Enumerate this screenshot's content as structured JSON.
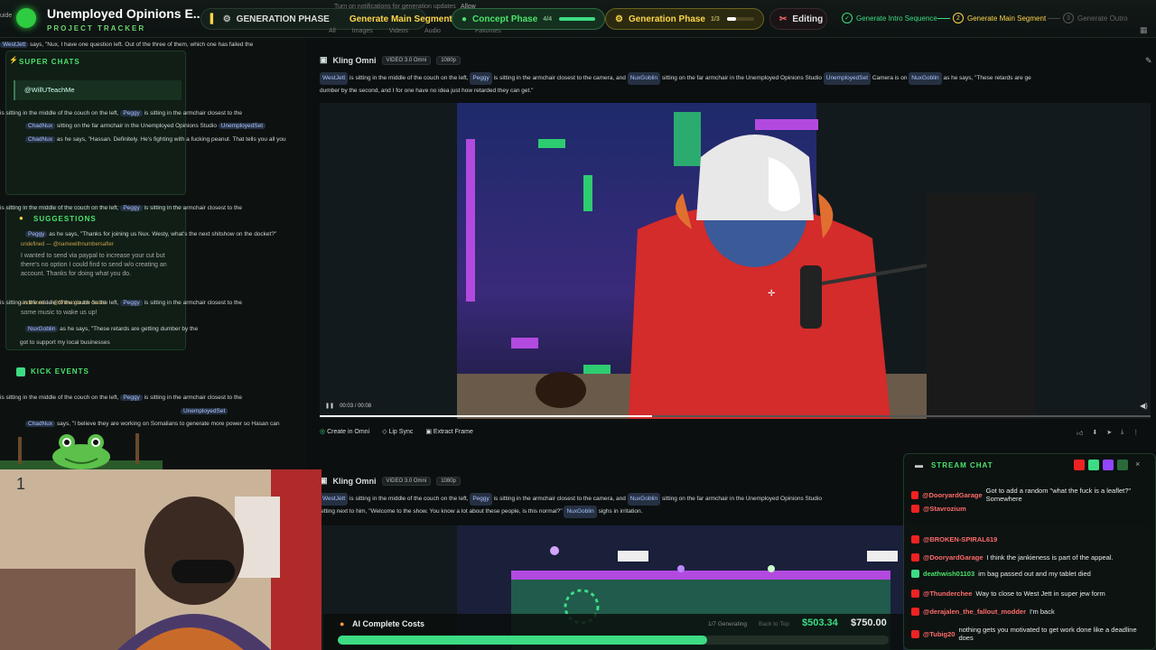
{
  "colors": {
    "accent": "#3ddc84",
    "warn": "#ffd54a",
    "bg": "#0b0f10"
  },
  "topbar": {
    "app_title": "Unemployed Opinions E...",
    "app_subtitle": "PROJECT TRACKER",
    "left_edge": "uide",
    "phase_label": "GENERATION PHASE",
    "phase_action": "Generate Main Segment",
    "notify_text": "Turn on notifications for generation updates",
    "notify_allow": "Allow",
    "filter_tabs": [
      "All",
      "Images",
      "Videos",
      "Audio",
      "Favorites"
    ],
    "concept_phase": {
      "label": "Concept Phase",
      "progress_text": "4/4",
      "fraction": 1.0
    },
    "generation_phase": {
      "label": "Generation Phase",
      "progress_text": "1/3",
      "fraction": 0.33
    },
    "editing_label": "Editing",
    "steps": [
      {
        "num": "✓",
        "label": "Generate Intro Sequence"
      },
      {
        "num": "2",
        "label": "Generate Main Segment"
      },
      {
        "num": "3",
        "label": "Generate Outro"
      }
    ]
  },
  "left": {
    "line0": "says, \"Nux, I have one question left. Out of the three of them, which one has failed the",
    "super_chats_title": "SUPER CHATS",
    "super_chat_user": "@WillUTeachMe",
    "suggestions_title": "SUGGESTIONS",
    "suggestion_user": "undefined — @namewithnumbersafter",
    "suggestion_text": "I wanted to send via paypal to increase your cut but there's no option I could find to send w/o creating an account. Thanks for doing what you do.",
    "suggestion2": "undefined — @Shmalgle the Salad",
    "suggestion2_text": "some music to wake us up!",
    "kick_events_title": "KICK EVENTS",
    "ghost_lines": [
      "is sitting in the middle of the couch on the left,",
      "is sitting in the armchair closest to the",
      "sitting on the far armchair in the Unemployed Opinions Studio",
      "as he says, \"Hassan. Definitely. He's fighting with a fucking peanut. That tells you all you",
      "as he says, \"Thanks for joining us Nux. Westy, what's the next shitshow on the docket?\"",
      "as he says, \"These retards are getting dumber by the",
      "got to support my local businesses",
      "says, \"I believe they are working on Somalians to generate more power so Hasan can"
    ],
    "chips": [
      "WestJett",
      "Peggy",
      "UnemployedSet",
      "ChadNux",
      "NuxGoblin"
    ]
  },
  "main": {
    "card1": {
      "title": "Kling Omni",
      "badges": [
        "VIDEO 3.0 Omni",
        "1080p"
      ],
      "prompt1": "is sitting in the middle of the couch on the left,",
      "prompt2": "is sitting in the armchair closest to the camera, and",
      "prompt3": "sitting on the far armchair in the Unemployed Opinions Studio",
      "prompt4": "Camera is on",
      "prompt5": "as he says, \"These retards are ge",
      "prompt_line2": "dumber by the second, and I for one have no idea just how retarded they can get.\"",
      "time": "00:03 / 00:08",
      "progress": 0.4,
      "actions": [
        "Create in Omni",
        "Lip Sync",
        "Extract Frame"
      ]
    },
    "card2": {
      "title": "Kling Omni",
      "badges": [
        "VIDEO 3.0 Omni",
        "1080p"
      ],
      "prompt1": "is sitting in the middle of the couch on the left,",
      "prompt2": "is sitting in the armchair closest to the camera, and",
      "prompt3": "sitting on the far armchair in the Unemployed Opinions Studio",
      "prompt_line2a": "sitting next to him, \"Welcome to the show. You know a lot about these people, is this normal?\"",
      "prompt_line2b": "sighs in irritation."
    },
    "chips": {
      "a": "WestJett",
      "b": "Peggy",
      "c": "NuxGoblin",
      "d": "UnemployedSet"
    }
  },
  "chat": {
    "title": "STREAM CHAT",
    "messages": [
      {
        "user": "@DooryardGarage",
        "text": "Got to add a random \"what the fuck is a leaflet?\" Somewhere",
        "platform": "yt"
      },
      {
        "user": "@Stavrozium",
        "text": "",
        "platform": "yt"
      },
      {
        "user": "@BROKEN-SPIRAL619",
        "text": "",
        "platform": "yt"
      },
      {
        "user": "@DooryardGarage",
        "text": "I think the jankieness is part of the appeal.",
        "platform": "yt"
      },
      {
        "user": "deathwish01103",
        "text": "im bag passed out and my tablet died",
        "platform": "kick"
      },
      {
        "user": "@Thunderchee",
        "text": "Way to close to West Jett in super jew form",
        "platform": "yt"
      },
      {
        "user": "@derajalen_the_fallout_modder",
        "text": "I'm back",
        "platform": "yt"
      },
      {
        "user": "@Tubig20",
        "text": "nothing gets you motivated to get work done like a deadline does",
        "platform": "yt"
      }
    ]
  },
  "costs": {
    "label": "AI Complete Costs",
    "generating": "1/7 Generating",
    "back_to_top": "Back to Top",
    "spent": "$503.34",
    "budget": "$750.00",
    "fraction": 0.67
  },
  "webcam": {
    "label": "1"
  }
}
